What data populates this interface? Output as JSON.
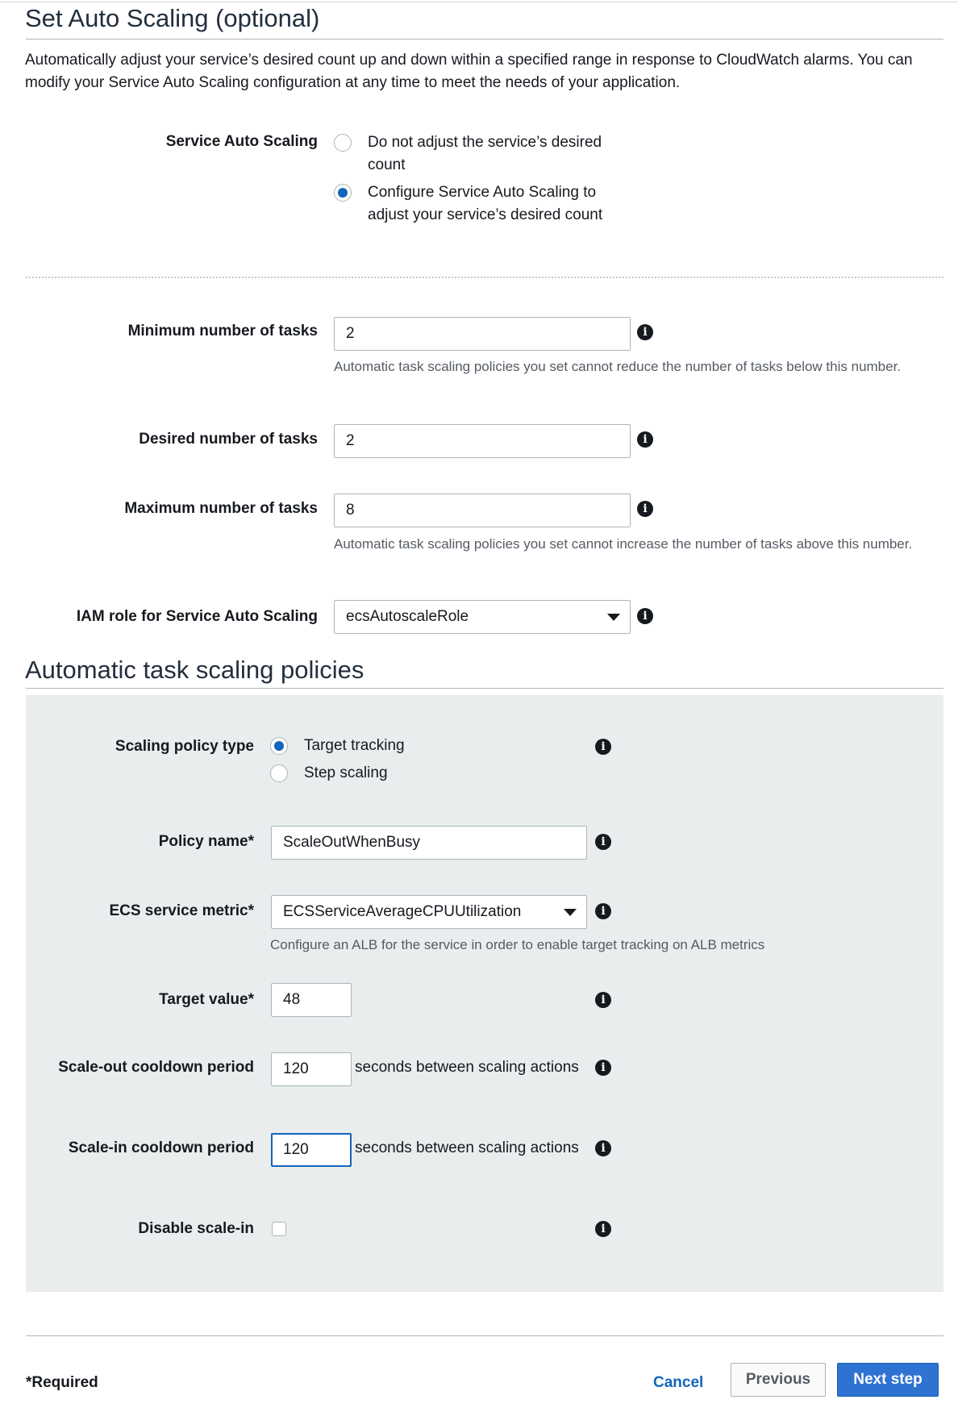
{
  "auto_scaling": {
    "title": "Set Auto Scaling (optional)",
    "description": "Automatically adjust your service’s desired count up and down within a specified range in response to CloudWatch alarms. You can modify your Service Auto Scaling configuration at any time to meet the needs of your application.",
    "service_auto_scaling": {
      "label": "Service Auto Scaling",
      "options": [
        {
          "label": "Do not adjust the service’s desired count",
          "selected": false
        },
        {
          "label": "Configure Service Auto Scaling to adjust your service’s desired count",
          "selected": true
        }
      ]
    },
    "min_tasks": {
      "label": "Minimum number of tasks",
      "value": "2",
      "help": "Automatic task scaling policies you set cannot reduce the number of tasks below this number."
    },
    "desired_tasks": {
      "label": "Desired number of tasks",
      "value": "2"
    },
    "max_tasks": {
      "label": "Maximum number of tasks",
      "value": "8",
      "help": "Automatic task scaling policies you set cannot increase the number of tasks above this number."
    },
    "iam_role": {
      "label": "IAM role for Service Auto Scaling",
      "value": "ecsAutoscaleRole"
    }
  },
  "policies": {
    "title": "Automatic task scaling policies",
    "policy_type": {
      "label": "Scaling policy type",
      "options": [
        {
          "label": "Target tracking",
          "selected": true
        },
        {
          "label": "Step scaling",
          "selected": false
        }
      ]
    },
    "policy_name": {
      "label": "Policy name*",
      "value": "ScaleOutWhenBusy"
    },
    "metric": {
      "label": "ECS service metric*",
      "value": "ECSServiceAverageCPUUtilization",
      "help": "Configure an ALB for the service in order to enable target tracking on ALB metrics"
    },
    "target_value": {
      "label": "Target value*",
      "value": "48"
    },
    "scale_out": {
      "label": "Scale-out cooldown period",
      "value": "120",
      "suffix": "seconds between scaling actions"
    },
    "scale_in": {
      "label": "Scale-in cooldown period",
      "value": "120",
      "suffix": "seconds between scaling actions"
    },
    "disable_scale_in": {
      "label": "Disable scale-in",
      "checked": false
    }
  },
  "footer": {
    "required_note": "*Required",
    "cancel": "Cancel",
    "previous": "Previous",
    "next": "Next step"
  },
  "colors": {
    "accent": "#1166bb",
    "primary_button": "#2e73d1",
    "panel_bg": "#eaeded"
  }
}
